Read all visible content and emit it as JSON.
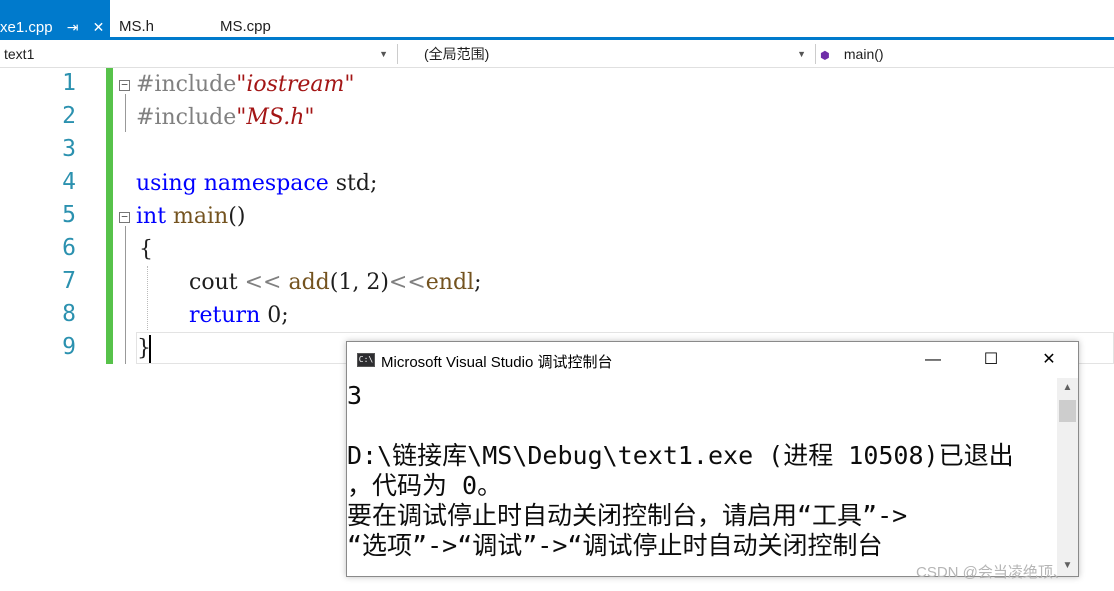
{
  "tabs": [
    {
      "label": "xe1.cpp",
      "active": true
    },
    {
      "label": "MS.h",
      "active": false
    },
    {
      "label": "MS.cpp",
      "active": false
    }
  ],
  "tab_pin_glyph": "⇥",
  "tab_close_glyph": "✕",
  "navbar": {
    "project": "text1",
    "scope": "(全局范围)",
    "member": "main()"
  },
  "editor": {
    "line_numbers": [
      "1",
      "2",
      "3",
      "4",
      "5",
      "6",
      "7",
      "8",
      "9"
    ],
    "code": {
      "l1_directive": "#include",
      "l1_string": "\"iostream\"",
      "l2_directive": "#include",
      "l2_string": "\"MS.h\"",
      "l4_kw1": "using",
      "l4_kw2": "namespace",
      "l4_rest": " std;",
      "l5_kw": "int",
      "l5_fn": "main",
      "l5_rest": "()",
      "l6": "{",
      "l7_a": "cout",
      "l7_op": "<<",
      "l7_fn": "add",
      "l7_args": "(1, 2)",
      "l7_op2": "<<",
      "l7_endl": "endl",
      "l7_end": ";",
      "l8_kw": "return",
      "l8_rest": " 0;",
      "l9": "}"
    }
  },
  "console": {
    "title": "Microsoft Visual Studio 调试控制台",
    "icon_text": "C:\\",
    "minimize": "—",
    "maximize": "☐",
    "close": "✕",
    "lines": [
      "3",
      "",
      "D:\\链接库\\MS\\Debug\\text1.exe (进程 10508)已退出",
      "，代码为 0。",
      "要在调试停止时自动关闭控制台，请启用“工具”->",
      "“选项”->“调试”->“调试停止时自动关闭控制台"
    ]
  },
  "watermark": "CSDN @会当凌绝顶、",
  "colors": {
    "accent": "#007acc",
    "line_number": "#2b91af",
    "keyword": "#0000ff",
    "string": "#a31515",
    "change_bar": "#57c24a"
  }
}
